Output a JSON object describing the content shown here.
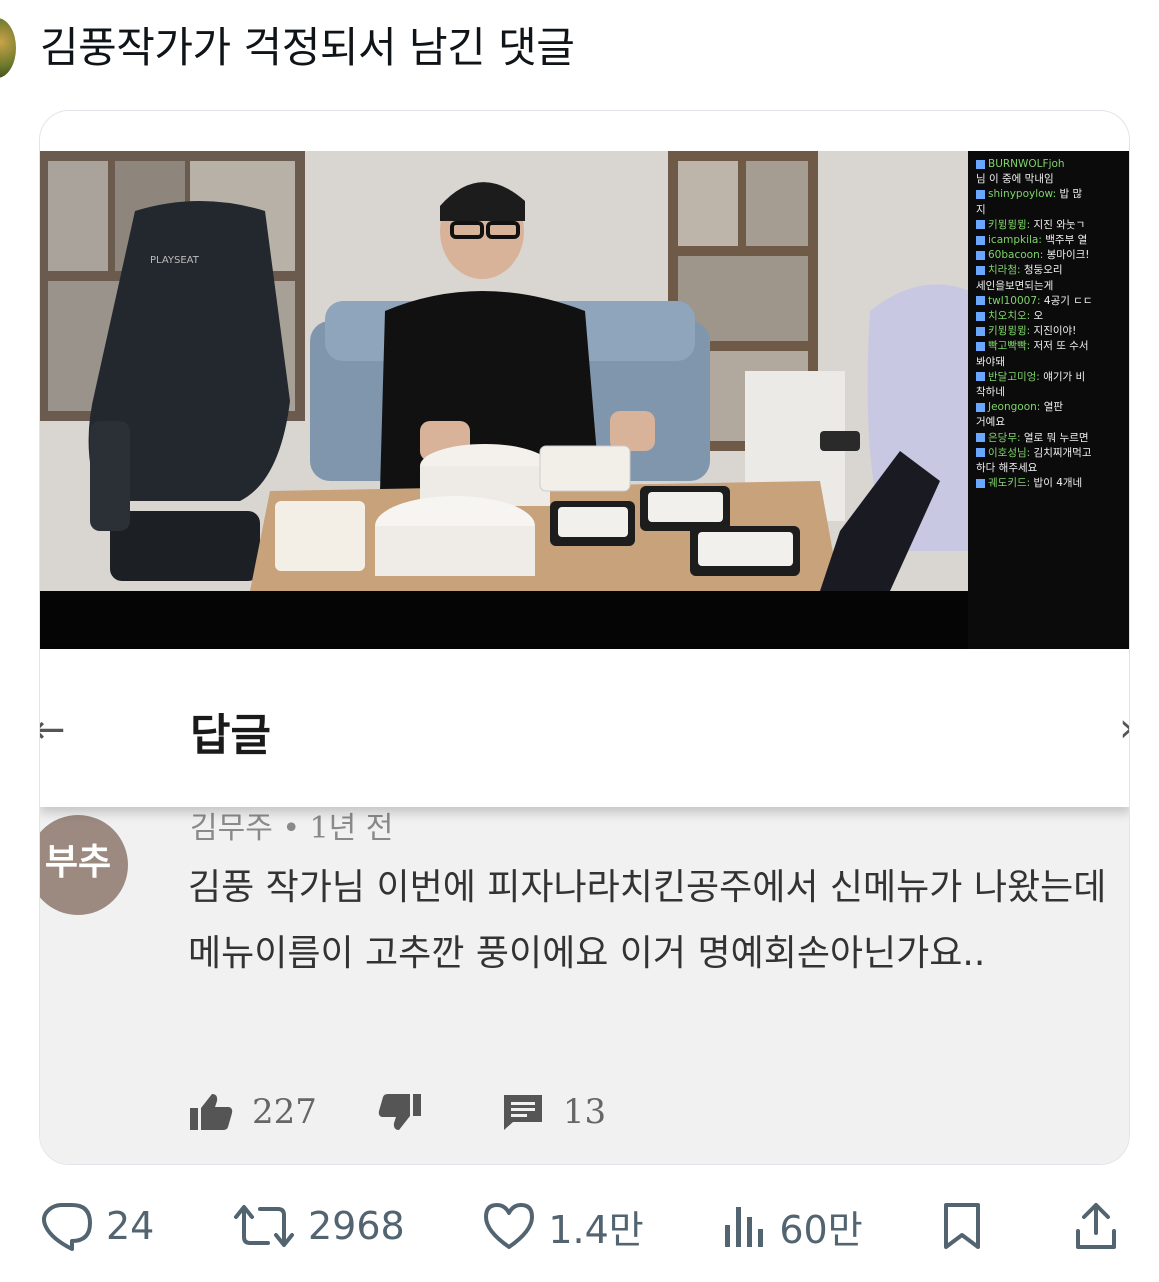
{
  "tweet": {
    "text": "김풍작가가 걱정되서 남긴 댓글"
  },
  "video": {
    "chair_brand": "PLAYSEAT",
    "chat": [
      {
        "user": "BURNWOLFjoh",
        "msg": ""
      },
      {
        "user": "",
        "msg": "님 이 중에 막내임"
      },
      {
        "user": "shinypoylow:",
        "msg": "밥 많"
      },
      {
        "user": "",
        "msg": "지"
      },
      {
        "user": "키뮝뮝뮝:",
        "msg": "지진 와눗ㄱ"
      },
      {
        "user": "icampkila:",
        "msg": "백주부 열"
      },
      {
        "user": "60bacoon:",
        "msg": "봉마이크!"
      },
      {
        "user": "치라첨:",
        "msg": "청둥오리"
      },
      {
        "user": "",
        "msg": "세인을보면되는게"
      },
      {
        "user": "twl10007:",
        "msg": "4공기 ㄷㄷ"
      },
      {
        "user": "치오치오:",
        "msg": "오"
      },
      {
        "user": "키뮝뮝뮝:",
        "msg": "지진이야!"
      },
      {
        "user": "빡고빡빡:",
        "msg": "저저 또 수서"
      },
      {
        "user": "",
        "msg": "봐야돼"
      },
      {
        "user": "반달고미엉:",
        "msg": "얘기가 비"
      },
      {
        "user": "",
        "msg": "착하네"
      },
      {
        "user": "Jeongoon:",
        "msg": "열판"
      },
      {
        "user": "",
        "msg": "거예요"
      },
      {
        "user": "은당무:",
        "msg": "열로 뭐 누르면"
      },
      {
        "user": "이호성님:",
        "msg": "김치찌개먹고"
      },
      {
        "user": "",
        "msg": "하다 해주세요"
      },
      {
        "user": "궤도키드:",
        "msg": "밥이 4개네"
      }
    ]
  },
  "reply_panel": {
    "title": "답글",
    "back_glyph": "←",
    "next_glyph": "›"
  },
  "comment": {
    "avatar_text": "부추",
    "meta": "김무주 • 1년 전",
    "body": "김풍 작가님 이번에 피자나라치킨공주에서 신메뉴가 나왔는데 메뉴이름이 고추깐 풍이에요 이거 명예회손아닌가요..",
    "likes": "227",
    "replies": "13"
  },
  "actions": {
    "replies": "24",
    "retweets": "2968",
    "likes": "1.4만",
    "views": "60만",
    "icons": [
      "reply-icon",
      "retweet-icon",
      "like-icon",
      "views-icon",
      "bookmark-icon",
      "share-icon"
    ]
  },
  "colors": {
    "icon_gray": "#536471",
    "chat_user_green": "#7fd46a"
  }
}
